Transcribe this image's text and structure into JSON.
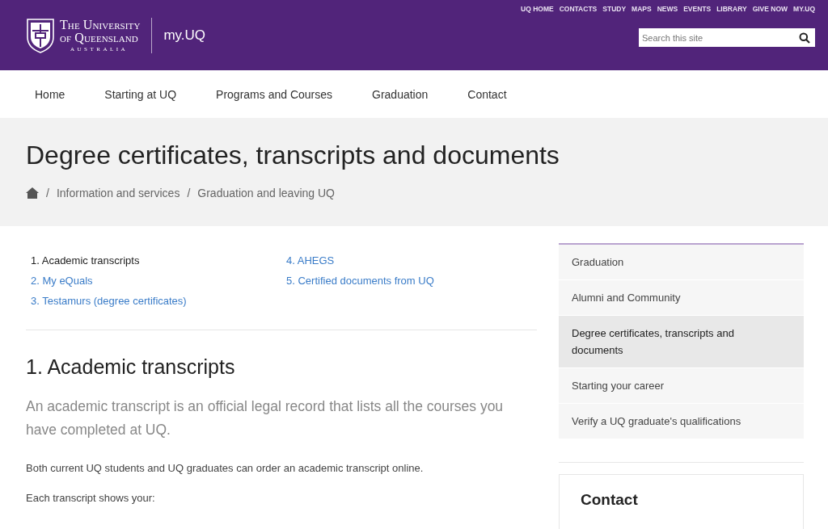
{
  "header": {
    "logo_lines": [
      "The University",
      "of Queensland",
      "AUSTRALIA"
    ],
    "site_name": "my.UQ",
    "utility_links": [
      "UQ HOME",
      "CONTACTS",
      "STUDY",
      "MAPS",
      "NEWS",
      "EVENTS",
      "LIBRARY",
      "GIVE NOW",
      "MY.UQ"
    ],
    "search": {
      "placeholder": "Search this site"
    }
  },
  "nav": [
    "Home",
    "Starting at UQ",
    "Programs and Courses",
    "Graduation",
    "Contact"
  ],
  "page_title": "Degree certificates, transcripts and documents",
  "breadcrumb": {
    "separator": "/",
    "items": [
      "Information and services",
      "Graduation and leaving UQ"
    ]
  },
  "contents": [
    {
      "label": "1. Academic transcripts",
      "selected": true
    },
    {
      "label": "2. My eQuals",
      "selected": false
    },
    {
      "label": "3. Testamurs (degree certificates)",
      "selected": false
    },
    {
      "label": "4. AHEGS",
      "selected": false
    },
    {
      "label": "5. Certified documents from UQ",
      "selected": false
    }
  ],
  "section": {
    "heading": "1. Academic transcripts",
    "lead": "An academic transcript is an official legal record that lists all the courses you have completed at UQ.",
    "paragraphs": [
      "Both current UQ students and UQ graduates can order an academic transcript online.",
      "Each transcript shows your:"
    ]
  },
  "sidebar": {
    "items": [
      {
        "label": "Graduation",
        "selected": false
      },
      {
        "label": "Alumni and Community",
        "selected": false
      },
      {
        "label": "Degree certificates, transcripts and documents",
        "selected": true
      },
      {
        "label": "Starting your career",
        "selected": false
      },
      {
        "label": "Verify a UQ graduate's qualifications",
        "selected": false
      }
    ],
    "contact_heading": "Contact"
  }
}
